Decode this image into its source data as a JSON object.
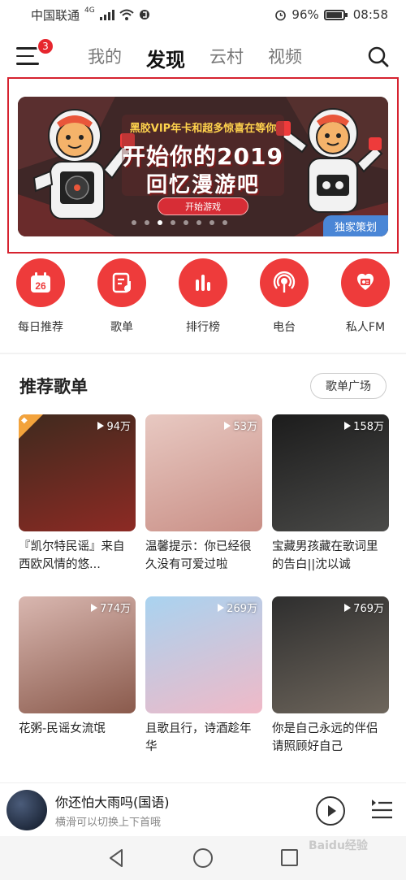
{
  "status_bar": {
    "carrier": "中国联通",
    "network": "4G",
    "battery": "96%",
    "battery_level": 0.96,
    "time": "08:58"
  },
  "header": {
    "menu_badge": "3",
    "tabs": [
      {
        "label": "我的",
        "active": false
      },
      {
        "label": "发现",
        "active": true
      },
      {
        "label": "云村",
        "active": false
      },
      {
        "label": "视频",
        "active": false
      }
    ]
  },
  "banner": {
    "subtitle": "黑胶VIP年卡和超多惊喜在等你",
    "title_line1": "开始你的2019",
    "title_line2": "回忆漫游吧",
    "cta": "开始游戏",
    "tag": "独家策划",
    "dots_total": 8,
    "dots_active": 2
  },
  "shortcuts": [
    {
      "label": "每日推荐",
      "icon": "calendar-icon",
      "day": "26"
    },
    {
      "label": "歌单",
      "icon": "playlist-icon"
    },
    {
      "label": "排行榜",
      "icon": "chart-bars-icon"
    },
    {
      "label": "电台",
      "icon": "radio-broadcast-icon"
    },
    {
      "label": "私人FM",
      "icon": "radio-fm-icon"
    }
  ],
  "section": {
    "title": "推荐歌单",
    "more_button": "歌单广场"
  },
  "playlists": [
    {
      "plays": "94万",
      "title": "『凯尔特民谣』来自西欧风情的悠...",
      "color1": "#3f2a1e",
      "color2": "#8d2a24"
    },
    {
      "plays": "53万",
      "title": "温馨提示：你已经很久没有可爱过啦",
      "color1": "#e8c9c2",
      "color2": "#c98f86"
    },
    {
      "plays": "158万",
      "title": "宝藏男孩藏在歌词里的告白||沈以诚",
      "color1": "#1c1c1c",
      "color2": "#4a4a48"
    },
    {
      "plays": "774万",
      "title": "花粥-民谣女流氓",
      "color1": "#d9b7b0",
      "color2": "#8a5a4c"
    },
    {
      "plays": "269万",
      "title": "且歌且行，诗酒趁年华",
      "color1": "#a9d3f0",
      "color2": "#f0b9c7"
    },
    {
      "plays": "769万",
      "title": "你是自己永远的伴侣 请照顾好自己",
      "color1": "#2e2e2e",
      "color2": "#6e665c"
    }
  ],
  "player": {
    "song": "你还怕大雨吗(国语)",
    "hint": "横滑可以切换上下首哦"
  },
  "watermark": "Baidu经验",
  "colors": {
    "accent": "#ee3b3b",
    "badge": "#e6262e",
    "banner_outline": "#d6222f",
    "tag_blue": "#4a86d6"
  }
}
